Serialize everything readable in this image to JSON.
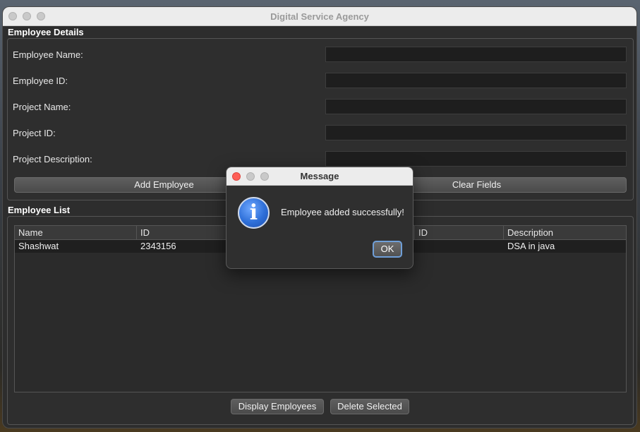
{
  "window": {
    "title": "Digital Service Agency"
  },
  "employee_details": {
    "section_title": "Employee Details",
    "fields": [
      {
        "label": "Employee Name:",
        "value": ""
      },
      {
        "label": "Employee ID:",
        "value": ""
      },
      {
        "label": "Project Name:",
        "value": ""
      },
      {
        "label": "Project ID:",
        "value": ""
      },
      {
        "label": "Project Description:",
        "value": ""
      }
    ],
    "add_button": "Add Employee",
    "clear_button": "Clear Fields"
  },
  "employee_list": {
    "section_title": "Employee List",
    "columns": [
      "Name",
      "ID",
      "",
      "ID",
      "Description"
    ],
    "rows": [
      [
        "Shashwat",
        "2343156",
        "",
        "",
        "DSA in java"
      ]
    ],
    "display_button": "Display Employees",
    "delete_button": "Delete Selected"
  },
  "dialog": {
    "title": "Message",
    "icon": "info-icon",
    "message": "Employee added successfully!",
    "ok_button": "OK"
  }
}
